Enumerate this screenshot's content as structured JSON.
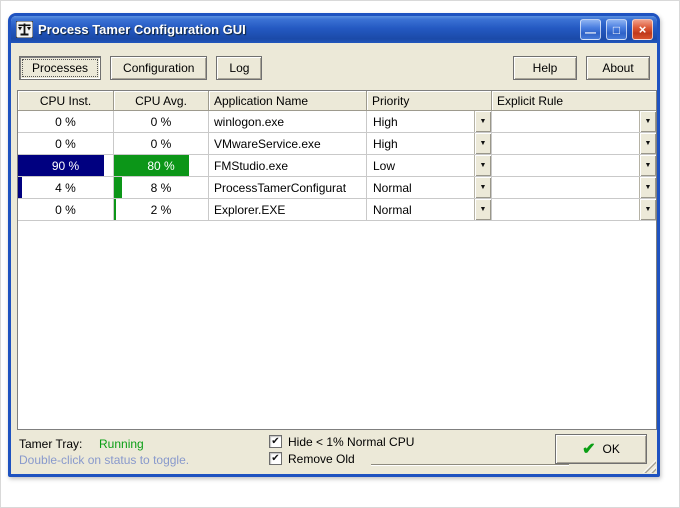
{
  "window": {
    "title": "Process Tamer Configuration GUI",
    "controls": {
      "minimize_glyph": "—",
      "maximize_glyph": "□",
      "close_glyph": "×"
    }
  },
  "toolbar": {
    "tabs": [
      {
        "label": "Processes",
        "active": true
      },
      {
        "label": "Configuration",
        "active": false
      },
      {
        "label": "Log",
        "active": false
      }
    ],
    "help_label": "Help",
    "about_label": "About"
  },
  "table": {
    "columns": [
      "CPU Inst.",
      "CPU Avg.",
      "Application Name",
      "Priority",
      "Explicit Rule"
    ],
    "rows": [
      {
        "cpu_inst": "0 %",
        "inst_pct": 0,
        "cpu_avg": "0 %",
        "avg_pct": 0,
        "app": "winlogon.exe",
        "priority": "High",
        "rule": ""
      },
      {
        "cpu_inst": "0 %",
        "inst_pct": 0,
        "cpu_avg": "0 %",
        "avg_pct": 0,
        "app": "VMwareService.exe",
        "priority": "High",
        "rule": ""
      },
      {
        "cpu_inst": "90 %",
        "inst_pct": 90,
        "cpu_avg": "80 %",
        "avg_pct": 80,
        "app": "FMStudio.exe",
        "priority": "Low",
        "rule": ""
      },
      {
        "cpu_inst": "4 %",
        "inst_pct": 4,
        "cpu_avg": "8 %",
        "avg_pct": 8,
        "app": "ProcessTamerConfigurat",
        "priority": "Normal",
        "rule": ""
      },
      {
        "cpu_inst": "0 %",
        "inst_pct": 0,
        "cpu_avg": "2 %",
        "avg_pct": 2,
        "app": "Explorer.EXE",
        "priority": "Normal",
        "rule": ""
      }
    ]
  },
  "footer": {
    "status_label": "Tamer Tray:",
    "status_value": "Running",
    "status_hint": "Double-click on status to toggle.",
    "checkboxes": [
      {
        "label": "Hide < 1% Normal CPU",
        "checked": true,
        "glyph": "✔"
      },
      {
        "label": "Remove Old",
        "checked": true,
        "glyph": "✔"
      }
    ],
    "ok_label": "OK",
    "ok_glyph": "✔"
  },
  "icons": {
    "dropdown_glyph": "▼"
  },
  "colors": {
    "inst_bar": "#000080",
    "avg_bar": "#0c9618",
    "status_running": "#0a9e14",
    "hint_text": "#8899cc"
  }
}
